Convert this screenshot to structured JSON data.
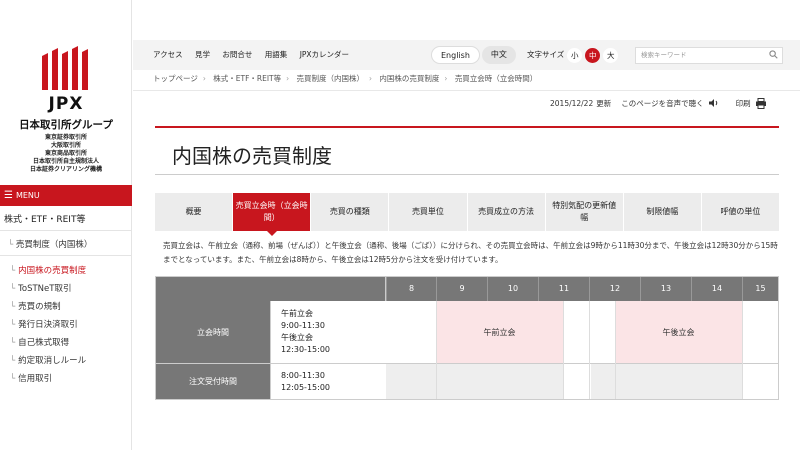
{
  "logo": {
    "brand": "JPX",
    "name": "日本取引所グループ",
    "subsidiaries": [
      "東京証券取引所",
      "大阪取引所",
      "東京商品取引所",
      "日本取引所自主規制法人",
      "日本証券クリアリング機構"
    ],
    "brand_color": "#c8161e"
  },
  "sidebar": {
    "menu_label": "MENU",
    "category": "株式・ETF・REIT等",
    "section": "売買制度（内国株）",
    "items": [
      {
        "label": "内国株の売買制度",
        "active": true
      },
      {
        "label": "ToSTNeT取引",
        "active": false
      },
      {
        "label": "売買の規制",
        "active": false
      },
      {
        "label": "発行日決済取引",
        "active": false
      },
      {
        "label": "自己株式取得",
        "active": false
      },
      {
        "label": "約定取消しルール",
        "active": false
      },
      {
        "label": "信用取引",
        "active": false
      }
    ]
  },
  "topnav": {
    "links": [
      "アクセス",
      "見学",
      "お問合せ",
      "用語集",
      "JPXカレンダー"
    ],
    "lang_en": "English",
    "lang_ja": "中文",
    "fontsize_label": "文字サイズ",
    "fontsize_options": [
      "小",
      "中",
      "大"
    ],
    "fontsize_selected": "中",
    "search_placeholder": "検索キーワード"
  },
  "breadcrumb": [
    "トップページ",
    "株式・ETF・REIT等",
    "売買制度（内国株）",
    "内国株の売買制度",
    "売買立会時（立会時間）"
  ],
  "datebar": {
    "date": "2015/12/22",
    "updated_label": "更新",
    "listen_label": "このページを音声で聴く",
    "print_label": "印刷"
  },
  "page_title": "内国株の売買制度",
  "tabs": [
    {
      "label": "概要",
      "active": false
    },
    {
      "label": "売買立会時（立会時間）",
      "active": true
    },
    {
      "label": "売買の種類",
      "active": false
    },
    {
      "label": "売買単位",
      "active": false
    },
    {
      "label": "売買成立の方法",
      "active": false
    },
    {
      "label": "特別気配の更新値幅",
      "active": false
    },
    {
      "label": "制限値幅",
      "active": false
    },
    {
      "label": "呼値の単位",
      "active": false
    }
  ],
  "description": "売買立会は、午前立会（通称、前場（ぜんば））と午後立会（通称、後場（ごば））に分けられ、その売買立会時は、午前立会は9時から11時30分まで、午後立会は12時30分から15時までとなっています。また、午前立会は8時から、午後立会は12時5分から注文を受け付けています。",
  "time_table": {
    "hours": [
      "8",
      "9",
      "10",
      "11",
      "12",
      "13",
      "14",
      "15"
    ],
    "rows": [
      {
        "label": "立会時間",
        "times": [
          "午前立会",
          "9:00-11:30",
          "午後立会",
          "12:30-15:00"
        ],
        "am_block": "午前立会",
        "pm_block": "午後立会"
      },
      {
        "label": "注文受付時間",
        "times": [
          "8:00-11:30",
          "12:05-15:00"
        ]
      }
    ],
    "colors": {
      "header": "#777777",
      "session": "#fbe4e6",
      "order": "#eeeeee"
    }
  }
}
